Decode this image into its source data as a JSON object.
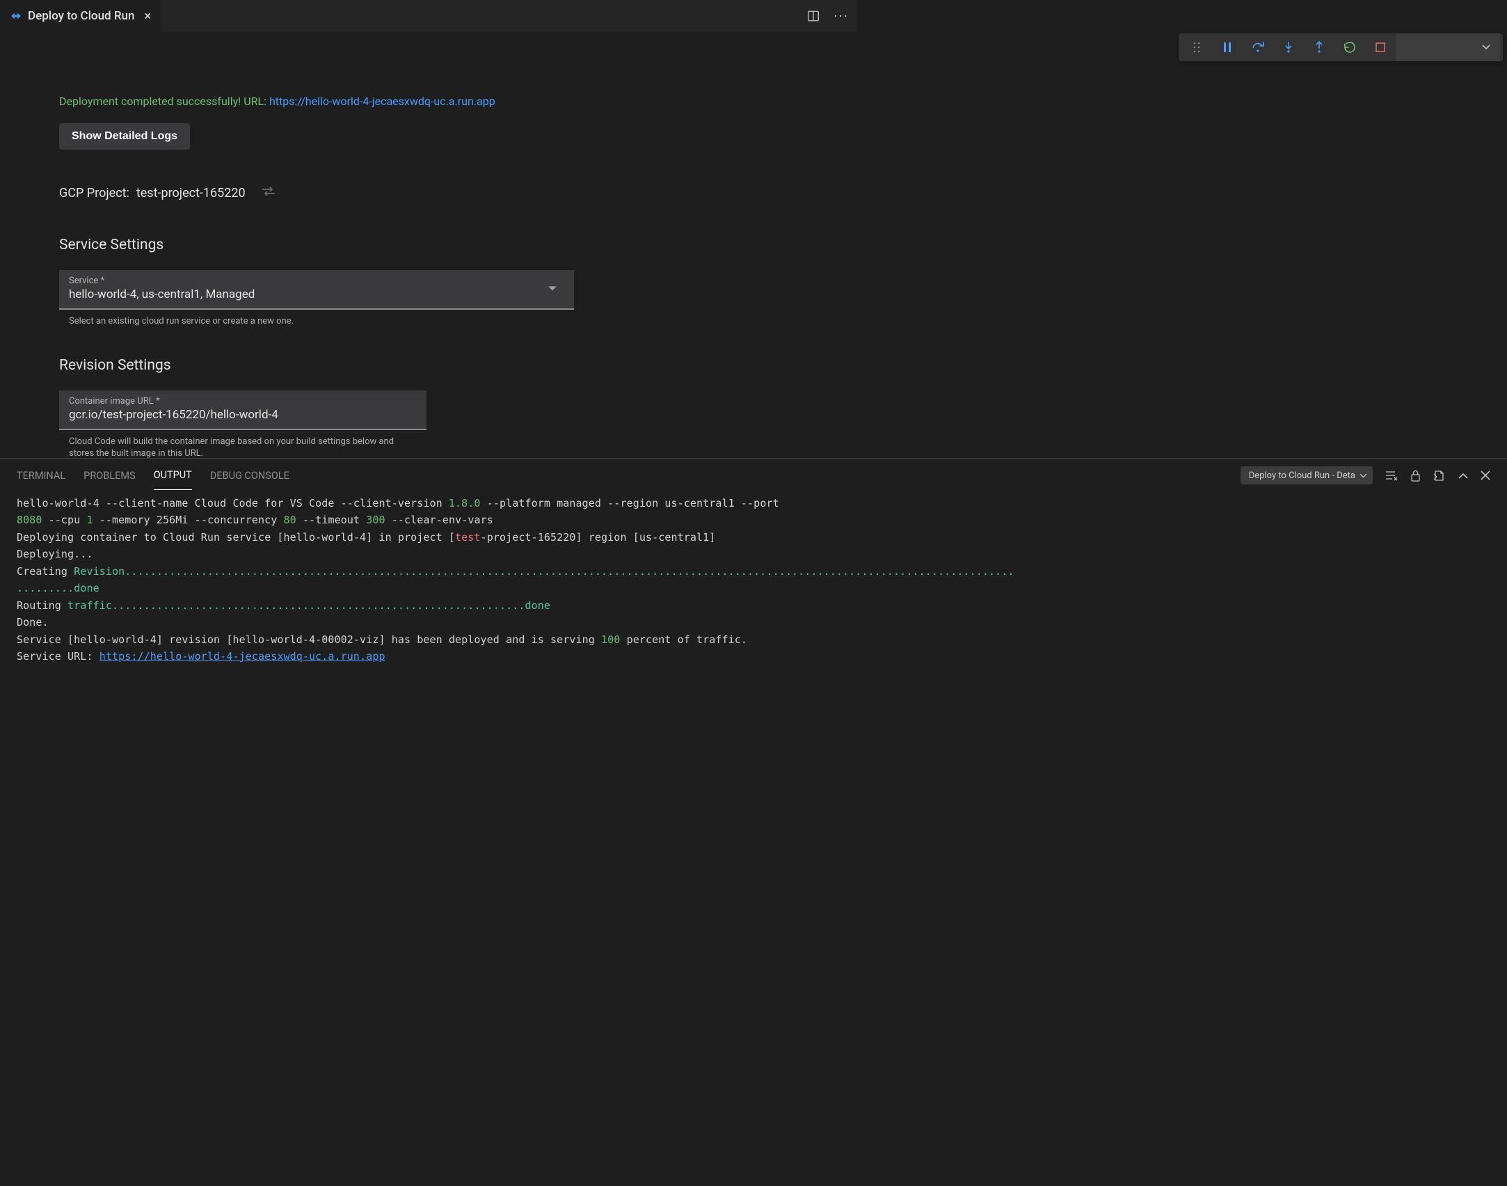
{
  "tab": {
    "title": "Deploy to Cloud Run"
  },
  "deploy": {
    "success_prefix": "Deployment completed successfully! URL: ",
    "success_url": "https://hello-world-4-jecaesxwdq-uc.a.run.app",
    "show_logs_btn": "Show Detailed Logs",
    "gcp_label": "GCP Project:",
    "gcp_value": "test-project-165220"
  },
  "service": {
    "heading": "Service Settings",
    "field_label": "Service *",
    "field_value": "hello-world-4, us-central1, Managed",
    "helper": "Select an existing cloud run service or create a new one."
  },
  "revision": {
    "heading": "Revision Settings",
    "image_label": "Container image URL *",
    "image_value": "gcr.io/test-project-165220/hello-world-4",
    "image_helper": "Cloud Code will build the container image based on your build settings below and stores the built image in this URL."
  },
  "panel": {
    "tabs": {
      "terminal": "TERMINAL",
      "problems": "PROBLEMS",
      "output": "OUTPUT",
      "debug": "DEBUG CONSOLE"
    },
    "select_value": "Deploy to Cloud Run - Deta"
  },
  "terminal": {
    "l1a": "hello-world-4 --client-name Cloud Code for VS Code --client-version ",
    "l1b": "1.8.0",
    "l1c": " --platform managed --region us-central1 --port",
    "l2a": "8080",
    "l2b": " --cpu ",
    "l2c": "1",
    "l2d": " --memory 256Mi --concurrency ",
    "l2e": "80",
    "l2f": " --timeout ",
    "l2g": "300",
    "l2h": " --clear-env-vars",
    "l3a": "Deploying container to Cloud Run service [hello-world-4] in project [",
    "l3b": "test",
    "l3c": "-project-165220] region [us-central1]",
    "l4": "Deploying...",
    "l5a": "Creating ",
    "l5b": "Revision",
    "l5c": "............................................................................................................................................",
    "l6a": ".........",
    "l6b": "done",
    "l7a": "Routing ",
    "l7b": "traffic",
    "l7c": ".................................................................",
    "l7d": "done",
    "l8": "Done.",
    "l9a": "Service [hello-world-4] revision [hello-world-4-00002-viz] has been deployed and is serving ",
    "l9b": "100",
    "l9c": " percent of traffic.",
    "l10a": "Service URL: ",
    "l10b": "https://hello-world-4-jecaesxwdq-uc.a.run.app"
  }
}
